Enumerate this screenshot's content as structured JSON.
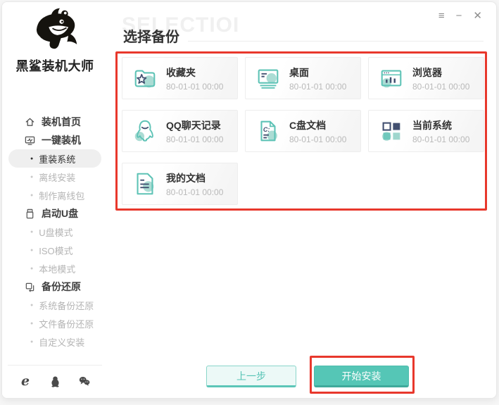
{
  "window": {
    "controls": {
      "menu_icon": "≡",
      "minimize_icon": "−",
      "close_icon": "✕"
    }
  },
  "sidebar": {
    "logo_text": "黑鲨装机大师",
    "nav": [
      {
        "label": "装机首页",
        "icon": "home-icon",
        "type": "section"
      },
      {
        "label": "一键装机",
        "icon": "one-key-install-icon",
        "type": "section"
      },
      {
        "label": "重装系统",
        "type": "sub",
        "active": true
      },
      {
        "label": "离线安装",
        "type": "sub"
      },
      {
        "label": "制作离线包",
        "type": "sub"
      },
      {
        "label": "启动U盘",
        "icon": "usb-drive-icon",
        "type": "section"
      },
      {
        "label": "U盘模式",
        "type": "sub"
      },
      {
        "label": "ISO模式",
        "type": "sub"
      },
      {
        "label": "本地模式",
        "type": "sub"
      },
      {
        "label": "备份还原",
        "icon": "backup-restore-icon",
        "type": "section"
      },
      {
        "label": "系统备份还原",
        "type": "sub"
      },
      {
        "label": "文件备份还原",
        "type": "sub"
      },
      {
        "label": "自定义安装",
        "type": "sub"
      }
    ],
    "footer_icons": [
      "ie-icon",
      "qq-icon",
      "wechat-icon"
    ]
  },
  "header": {
    "watermark": "SELECTIOI",
    "title": "选择备份"
  },
  "backup": {
    "cards": [
      {
        "title": "收藏夹",
        "time": "80-01-01 00:00",
        "icon": "favorites-folder-icon"
      },
      {
        "title": "桌面",
        "time": "80-01-01 00:00",
        "icon": "desktop-icon"
      },
      {
        "title": "浏览器",
        "time": "80-01-01 00:00",
        "icon": "browser-icon"
      },
      {
        "title": "QQ聊天记录",
        "time": "80-01-01 00:00",
        "icon": "qq-chat-icon"
      },
      {
        "title": "C盘文档",
        "time": "80-01-01 00:00",
        "icon": "c-drive-doc-icon"
      },
      {
        "title": "当前系统",
        "time": "80-01-01 00:00",
        "icon": "current-system-icon"
      },
      {
        "title": "我的文档",
        "time": "80-01-01 00:00",
        "icon": "my-documents-icon"
      }
    ]
  },
  "footer": {
    "prev_label": "上一步",
    "start_label": "开始安装"
  },
  "colors": {
    "accent": "#55c6b6",
    "annotation": "#e8382c",
    "navy": "#425070",
    "blob": "#abdcd4"
  }
}
